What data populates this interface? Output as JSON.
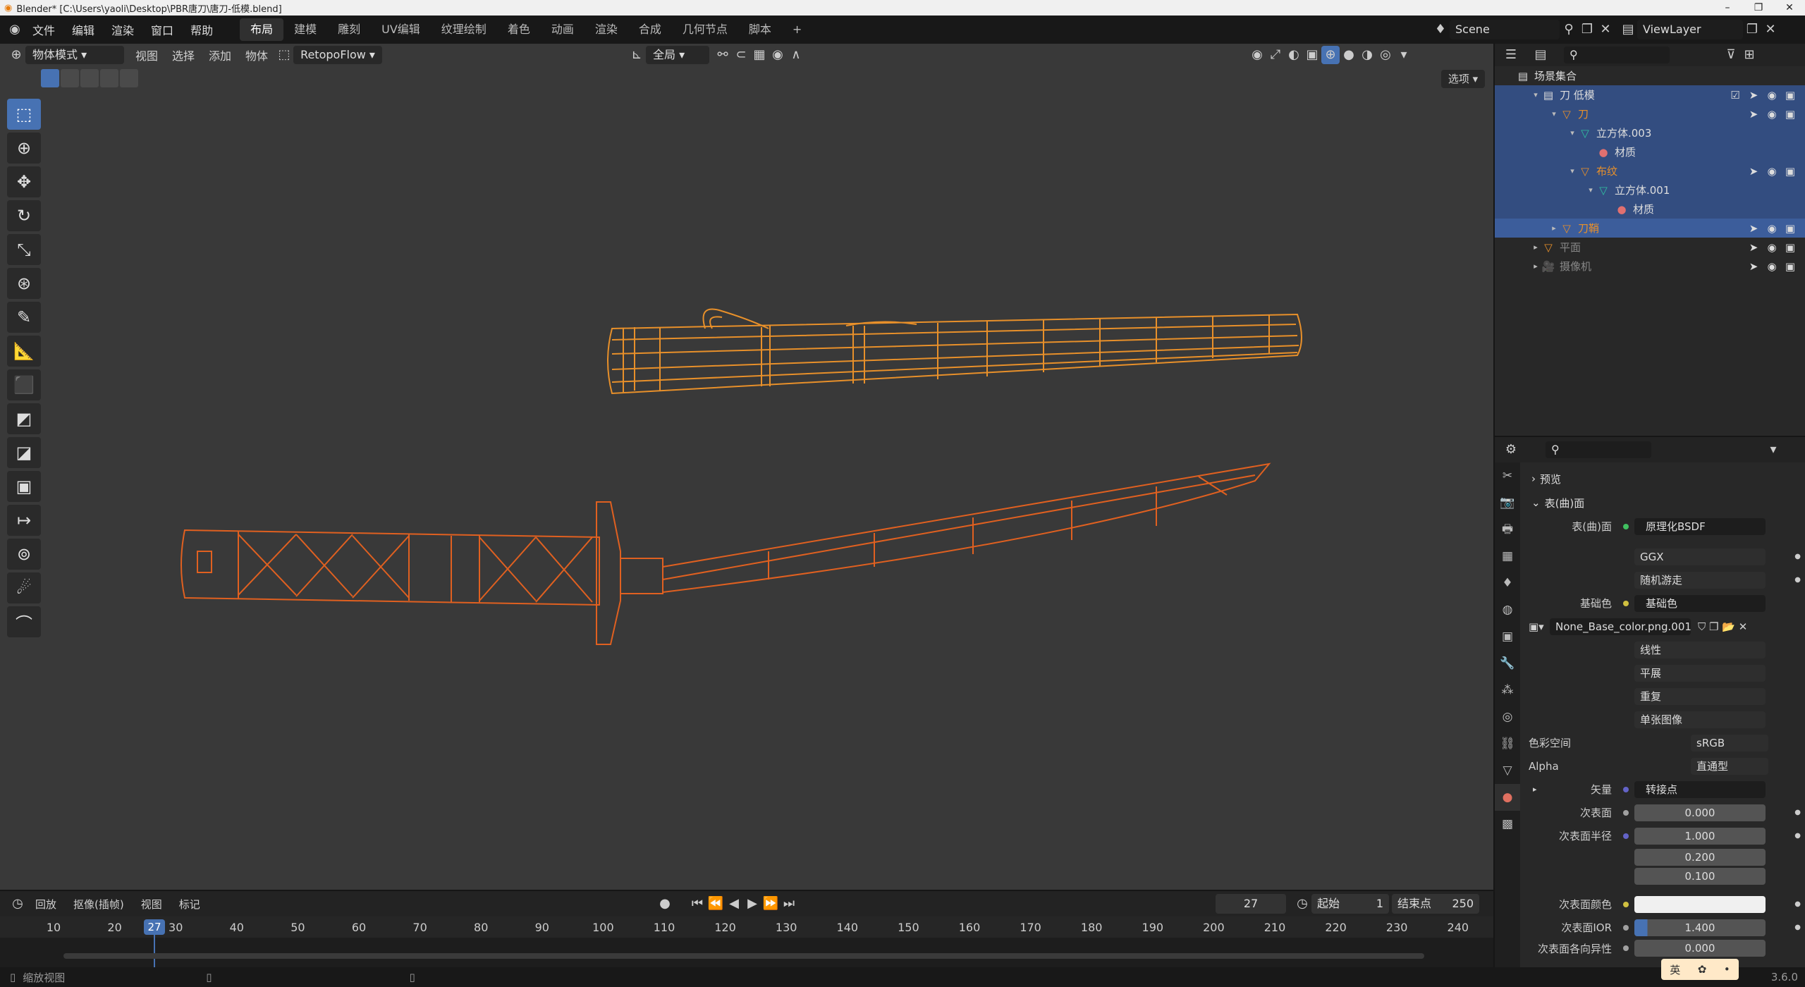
{
  "window": {
    "title": "Blender* [C:\\Users\\yaoli\\Desktop\\PBR唐刀\\唐刀-低模.blend]"
  },
  "topbar": {
    "menus": [
      "文件",
      "编辑",
      "渲染",
      "窗口",
      "帮助"
    ],
    "workspaces": [
      "布局",
      "建模",
      "雕刻",
      "UV编辑",
      "纹理绘制",
      "着色",
      "动画",
      "渲染",
      "合成",
      "几何节点",
      "脚本"
    ],
    "active_workspace": "布局",
    "scene": "Scene",
    "view_layer": "ViewLayer"
  },
  "viewport": {
    "mode": "物体模式",
    "menus": [
      "视图",
      "选择",
      "添加",
      "物体"
    ],
    "addon": "RetopoFlow",
    "transform_orientation": "全局",
    "options_label": "选项"
  },
  "outliner": {
    "root": "场景集合",
    "rows": [
      {
        "label": "刀 低模",
        "depth": 1,
        "icon": "collection-icon"
      },
      {
        "label": "刀",
        "depth": 2,
        "icon": "mesh-object-icon"
      },
      {
        "label": "立方体.003",
        "depth": 3,
        "icon": "mesh-data-icon"
      },
      {
        "label": "材质",
        "depth": 4,
        "icon": "material-icon"
      },
      {
        "label": "布纹",
        "depth": 3,
        "icon": "mesh-object-icon"
      },
      {
        "label": "立方体.001",
        "depth": 4,
        "icon": "mesh-data-icon"
      },
      {
        "label": "材质",
        "depth": 5,
        "icon": "material-icon"
      },
      {
        "label": "刀鞘",
        "depth": 2,
        "icon": "mesh-object-icon"
      },
      {
        "label": "平面",
        "depth": 1,
        "icon": "mesh-object-icon"
      },
      {
        "label": "摄像机",
        "depth": 1,
        "icon": "camera-icon"
      }
    ]
  },
  "properties": {
    "sections": {
      "preview": "预览",
      "surface": "表(曲)面"
    },
    "surface_label": "表(曲)面",
    "surface_value": "原理化BSDF",
    "distribution": "GGX",
    "subsurface_method": "随机游走",
    "base_color_label": "基础色",
    "base_color_value": "基础色",
    "image_name": "None_Base_color.png.001",
    "interpolation": "线性",
    "projection": "平展",
    "extension": "重复",
    "source": "单张图像",
    "color_space_label": "色彩空间",
    "color_space": "sRGB",
    "alpha_label": "Alpha",
    "alpha": "直通型",
    "vector_label": "矢量",
    "vector_value": "转接点",
    "subsurface_label": "次表面",
    "subsurface": "0.000",
    "subsurface_radius_label": "次表面半径",
    "subsurface_radius": [
      "1.000",
      "0.200",
      "0.100"
    ],
    "subsurface_color_label": "次表面颜色",
    "subsurface_ior_label": "次表面IOR",
    "subsurface_ior": "1.400",
    "subsurface_aniso_label": "次表面各向异性",
    "subsurface_aniso": "0.000"
  },
  "timeline": {
    "menus": [
      "回放",
      "抠像(插帧)",
      "视图",
      "标记"
    ],
    "current_frame": "27",
    "start_label": "起始",
    "start": "1",
    "end_label": "结束点",
    "end": "250",
    "ticks": [
      "10",
      "20",
      "30",
      "40",
      "50",
      "60",
      "70",
      "80",
      "90",
      "100",
      "110",
      "120",
      "130",
      "140",
      "150",
      "160",
      "170",
      "180",
      "190",
      "200",
      "210",
      "220",
      "230",
      "240"
    ]
  },
  "statusbar": {
    "hint": "缩放视图",
    "version": "3.6.0",
    "ime": "英"
  }
}
